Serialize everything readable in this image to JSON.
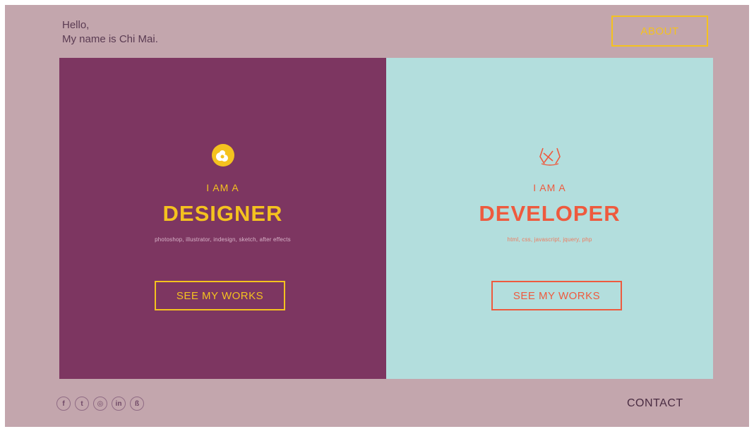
{
  "header": {
    "greeting_line1": "Hello,",
    "greeting_line2": "My name is Chi Mai.",
    "about_label": "ABOUT"
  },
  "designer": {
    "icon": "flower-icon",
    "intro": "I AM A",
    "role": "DESIGNER",
    "skills": "photoshop, illustrator, indesign, sketch, after effects",
    "button_label": "SEE MY WORKS"
  },
  "developer": {
    "icon": "code-icon",
    "intro": "I AM A",
    "role": "DEVELOPER",
    "skills": "html, css, javascript, jquery, php",
    "button_label": "SEE MY WORKS"
  },
  "footer": {
    "social": [
      {
        "icon": "facebook-icon",
        "glyph": "f"
      },
      {
        "icon": "twitter-icon",
        "glyph": "t"
      },
      {
        "icon": "instagram-icon",
        "glyph": "◎"
      },
      {
        "icon": "linkedin-icon",
        "glyph": "in"
      },
      {
        "icon": "behance-icon",
        "glyph": "ß"
      }
    ],
    "contact_label": "CONTACT"
  },
  "colors": {
    "background": "#c3a6ad",
    "designer_panel": "#7d3661",
    "developer_panel": "#b3dedd",
    "designer_accent": "#f4c21f",
    "developer_accent": "#ee5a3e"
  }
}
